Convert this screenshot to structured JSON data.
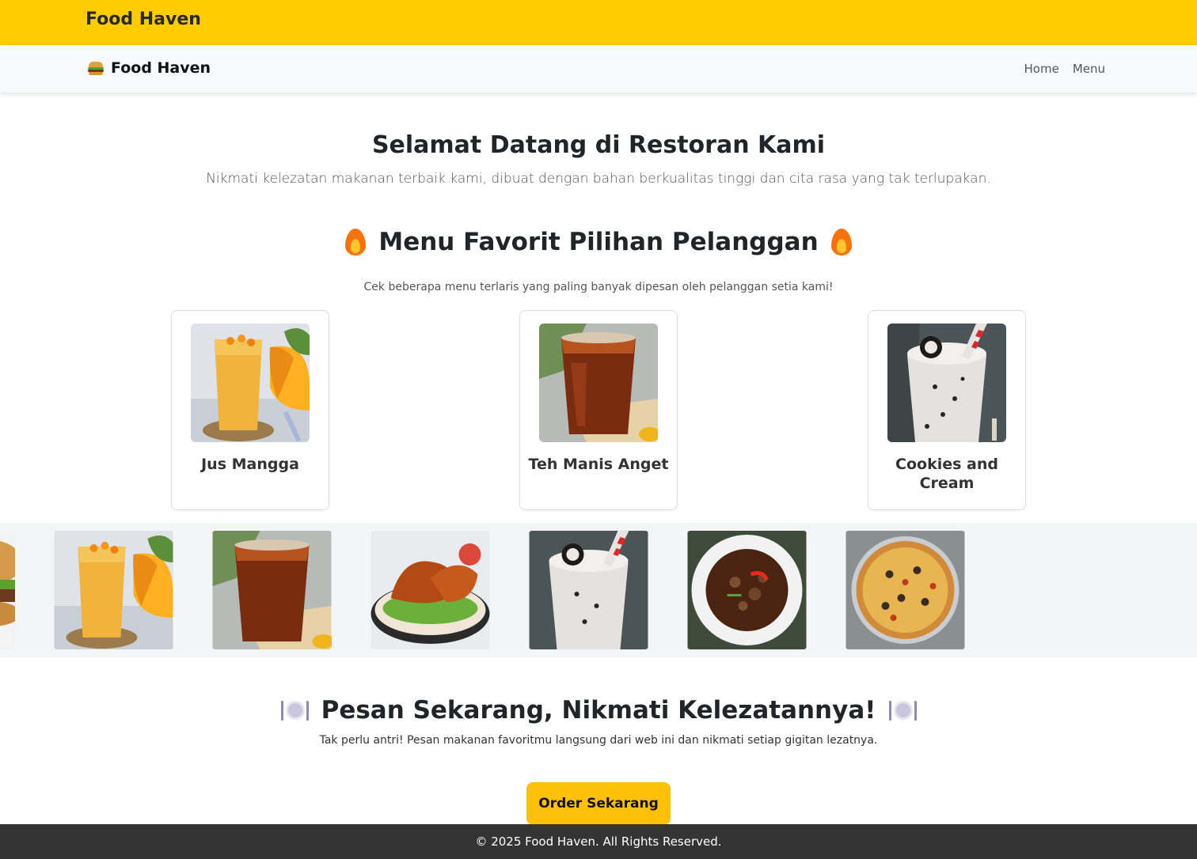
{
  "topbar": {
    "title": "Food Haven"
  },
  "navbar": {
    "brand": "Food Haven",
    "brand_icon": "burger-icon",
    "links": [
      {
        "label": "Home"
      },
      {
        "label": "Menu"
      }
    ]
  },
  "hero": {
    "title": "Selamat Datang di Restoran Kami",
    "subtitle": "Nikmati kelezatan makanan terbaik kami, dibuat dengan bahan berkualitas tinggi dan cita rasa yang tak terlupakan."
  },
  "favorites": {
    "title": "Menu Favorit Pilihan Pelanggan",
    "title_icon": "fire-icon",
    "subtitle": "Cek beberapa menu terlaris yang paling banyak dipesan oleh pelanggan setia kami!",
    "items": [
      {
        "name": "Jus Mangga",
        "image": "mango-juice-image"
      },
      {
        "name": "Teh Manis Anget",
        "image": "sweet-tea-image"
      },
      {
        "name": "Cookies and Cream",
        "image": "cookies-cream-image"
      }
    ]
  },
  "carousel": {
    "images": [
      "burger-image",
      "mango-juice-image",
      "sweet-tea-image",
      "grilled-chicken-image",
      "cookies-cream-image",
      "soup-image",
      "pizza-image"
    ]
  },
  "order": {
    "title": "Pesan Sekarang, Nikmati Kelezatannya!",
    "title_icon": "plate-cutlery-icon",
    "subtitle": "Tak perlu antri! Pesan makanan favoritmu langsung dari web ini dan nikmati setiap gigitan lezatnya.",
    "button": "Order Sekarang"
  },
  "footer": {
    "text": "© 2025 Food Haven. All Rights Reserved."
  },
  "colors": {
    "accent": "#ffcc00",
    "button": "#ffc107",
    "footer": "#343434",
    "navbar": "#f8f9fa"
  }
}
